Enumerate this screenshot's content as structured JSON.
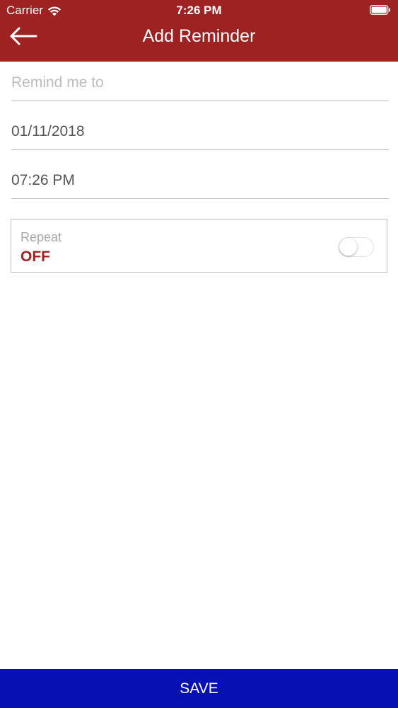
{
  "status_bar": {
    "carrier": "Carrier",
    "time": "7:26 PM",
    "wifi_icon": "wifi-icon",
    "battery_icon": "battery-icon"
  },
  "nav": {
    "title": "Add Reminder",
    "back_icon": "arrow-left-icon"
  },
  "form": {
    "task": {
      "placeholder": "Remind me to",
      "value": ""
    },
    "date": {
      "value": "01/11/2018"
    },
    "time": {
      "value": "07:26 PM"
    },
    "repeat": {
      "label": "Repeat",
      "value": "OFF",
      "enabled": false
    }
  },
  "footer": {
    "save_label": "SAVE"
  },
  "colors": {
    "header_bg": "#9f2222",
    "save_bg": "#0710b2",
    "repeat_value": "#9f2222"
  }
}
